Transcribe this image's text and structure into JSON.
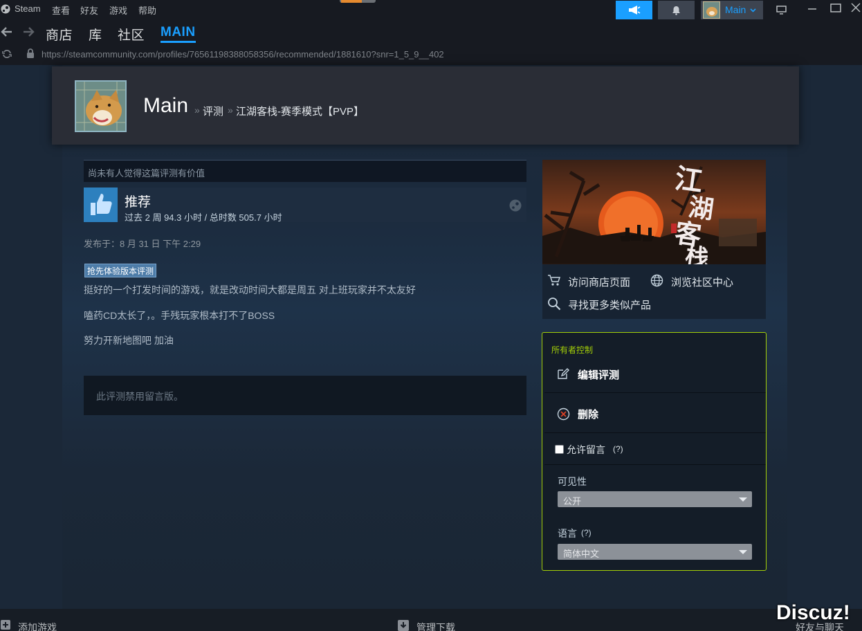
{
  "menu": {
    "steam": "Steam",
    "view": "查看",
    "friends": "好友",
    "games": "游戏",
    "help": "帮助"
  },
  "account": {
    "name": "Main"
  },
  "nav": {
    "tabs": [
      "商店",
      "库",
      "社区",
      "MAIN"
    ],
    "active_tab": "MAIN"
  },
  "url": "https://steamcommunity.com/profiles/76561198388058356/recommended/1881610?snr=1_5_9__402",
  "header": {
    "user_name": "Main",
    "sep": "»",
    "crumb1": "评测",
    "crumb2": "江湖客栈-赛季模式【PVP】"
  },
  "review": {
    "helpful_text": "尚未有人觉得这篇评测有价值",
    "verdict": "推荐",
    "hours": "过去 2 周 94.3 小时 / 总时数 505.7 小时",
    "posted": "发布于：8 月 31 日 下午 2:29",
    "early_access_badge": "抢先体验版本评测",
    "body": [
      "挺好的一个打发时间的游戏，就是改动时间大都是周五 对上班玩家并不太友好",
      "嗑药CD太长了，。手残玩家根本打不了BOSS",
      "努力开新地图吧 加油"
    ],
    "comments_disabled": "此评测禁用留言版。"
  },
  "sidebar": {
    "visit_store": "访问商店页面",
    "browse_hub": "浏览社区中心",
    "find_similar": "寻找更多类似产品",
    "game_logo_text": "江湖客栈"
  },
  "owner": {
    "title": "所有者控制",
    "edit": "编辑评测",
    "delete": "删除",
    "allow_comments": "允许留言",
    "help_mark": "(?)",
    "visibility_label": "可见性",
    "visibility_value": "公开",
    "language_label": "语言",
    "language_value": "简体中文"
  },
  "footer": {
    "add_game": "添加游戏",
    "manage_downloads": "管理下载",
    "friends_chat": "好友与聊天"
  },
  "watermark": "Discuz!",
  "colors": {
    "accent": "#1a9fff",
    "owner_border": "#a4d007",
    "owner_title": "#a4d007"
  }
}
